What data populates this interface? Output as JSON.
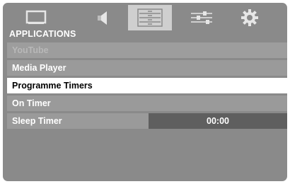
{
  "tabs": [
    {
      "icon": "tv-screen-icon",
      "active": false
    },
    {
      "icon": "speaker-icon",
      "active": false
    },
    {
      "icon": "list-icon",
      "active": true
    },
    {
      "icon": "sliders-icon",
      "active": false
    },
    {
      "icon": "gear-icon",
      "active": false
    }
  ],
  "section_title": "APPLICATIONS",
  "menu": {
    "items": [
      {
        "label": "YouTube",
        "state": "disabled"
      },
      {
        "label": "Media Player",
        "state": "normal"
      },
      {
        "label": "Programme Timers",
        "state": "selected"
      },
      {
        "label": "On Timer",
        "state": "normal"
      },
      {
        "label": "Sleep Timer",
        "state": "normal",
        "value": "00:00"
      }
    ]
  },
  "colors": {
    "background": "#8a8a8a",
    "row": "#9a9a9a",
    "selected_row": "#ffffff",
    "active_tab": "#cfcfcf",
    "value_box": "#5f5f5f"
  }
}
